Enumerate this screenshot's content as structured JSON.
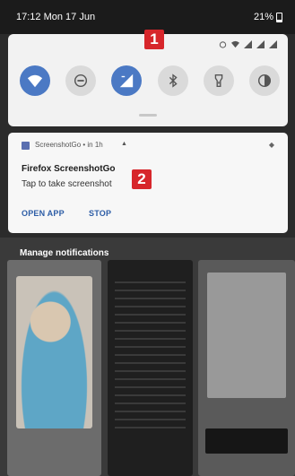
{
  "status_bar": {
    "time_date": "17:12  Mon 17 Jun",
    "battery": "21%"
  },
  "quick_settings": {
    "tiles": [
      {
        "icon": "wifi-icon",
        "state": "on"
      },
      {
        "icon": "do-not-disturb-icon",
        "state": "off"
      },
      {
        "icon": "mobile-data-icon",
        "state": "on"
      },
      {
        "icon": "bluetooth-icon",
        "state": "off"
      },
      {
        "icon": "flashlight-icon",
        "state": "off"
      },
      {
        "icon": "battery-saver-icon",
        "state": "off"
      }
    ]
  },
  "notification": {
    "app_name": "ScreenshotGo",
    "time": "in 1h",
    "title": "Firefox ScreenshotGo",
    "body": "Tap to take screenshot",
    "actions": {
      "open": "OPEN APP",
      "stop": "STOP"
    }
  },
  "annotations": {
    "badge1": "1",
    "badge2": "2"
  },
  "recents": {
    "manage_label": "Manage notifications"
  },
  "colors": {
    "accent": "#4b79c4",
    "badge": "#d7262b",
    "action_text": "#2d5da6"
  }
}
